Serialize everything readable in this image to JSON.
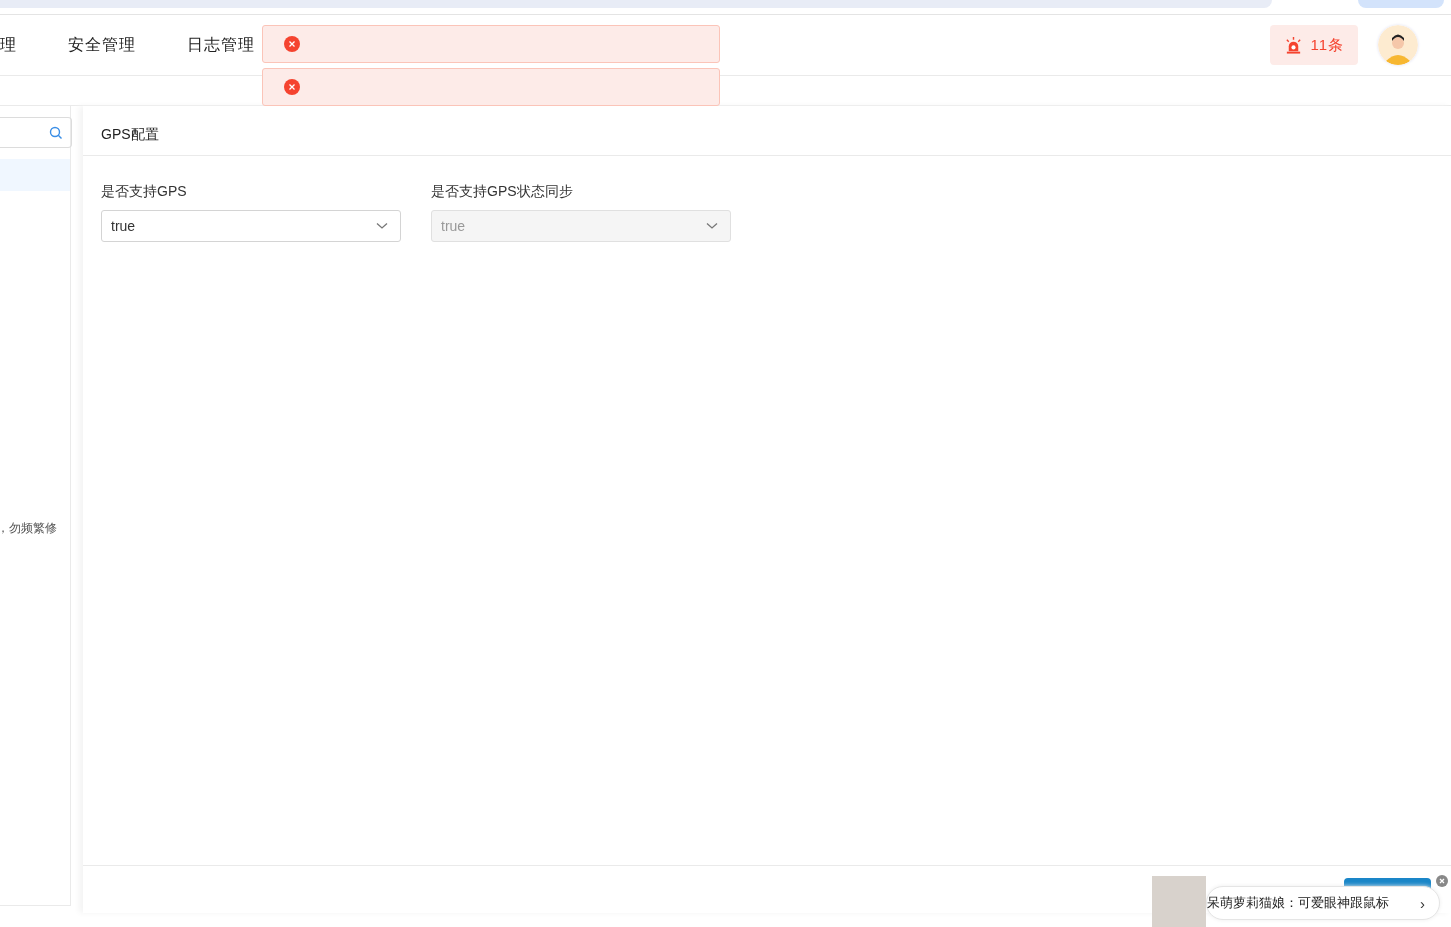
{
  "nav": {
    "items": [
      {
        "label": "理",
        "selected": false
      },
      {
        "label": "安全管理",
        "selected": false
      },
      {
        "label": "日志管理",
        "selected": false
      }
    ],
    "alarm": {
      "count": "11条"
    }
  },
  "toasts": [
    {
      "kind": "error"
    },
    {
      "kind": "error"
    }
  ],
  "sidebar": {
    "items": [
      {
        "selected": true
      }
    ],
    "note": "，勿频繁修"
  },
  "panel": {
    "title": "GPS配置",
    "fields": [
      {
        "label": "是否支持GPS",
        "value": "true",
        "disabled": false
      },
      {
        "label": "是否支持GPS状态同步",
        "value": "true",
        "disabled": true
      }
    ]
  },
  "popup": {
    "text": "呆萌萝莉猫娘：可爱眼神跟鼠标",
    "arrow": "›"
  }
}
